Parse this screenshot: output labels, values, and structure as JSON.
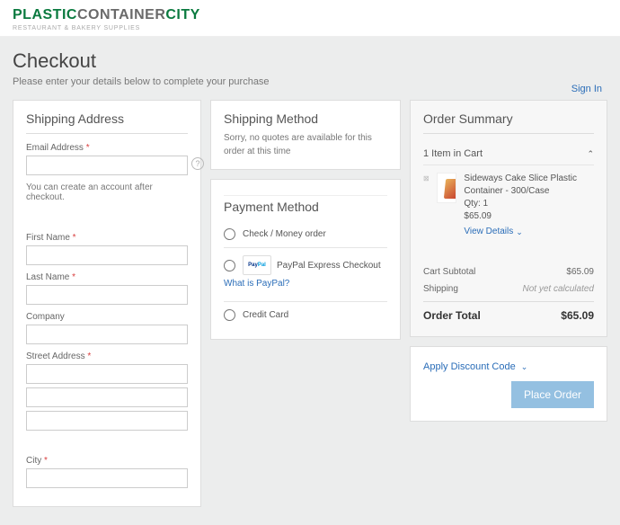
{
  "header": {
    "logo_p1": "PLASTIC",
    "logo_p2": "CONTAINER",
    "logo_p3": "CITY",
    "tagline": "RESTAURANT & BAKERY SUPPLIES"
  },
  "page": {
    "title": "Checkout",
    "lead": "Please enter your details below to complete your purchase",
    "signin": "Sign In"
  },
  "shipping_address": {
    "heading": "Shipping Address",
    "email_label": "Email Address",
    "email_value": "",
    "hint": "You can create an account after checkout.",
    "first_name_label": "First Name",
    "first_name_value": "",
    "last_name_label": "Last Name",
    "last_name_value": "",
    "company_label": "Company",
    "company_value": "",
    "street_label": "Street Address",
    "street1_value": "",
    "street2_value": "",
    "street3_value": "",
    "city_label": "City",
    "city_value": ""
  },
  "shipping_method": {
    "heading": "Shipping Method",
    "message": "Sorry, no quotes are available for this order at this time"
  },
  "payment": {
    "heading": "Payment Method",
    "options": [
      {
        "label": "Check / Money order"
      },
      {
        "label": "PayPal Express Checkout",
        "link": "What is PayPal?",
        "badge_p": "Pay",
        "badge_pal": "Pal"
      },
      {
        "label": "Credit Card"
      }
    ]
  },
  "summary": {
    "heading": "Order Summary",
    "cart_count_label": "1 Item in Cart",
    "item": {
      "name": "Sideways Cake Slice Plastic Container - 300/Case",
      "qty": "Qty: 1",
      "price": "$65.09",
      "view_details": "View Details"
    },
    "subtotal_label": "Cart Subtotal",
    "subtotal": "$65.09",
    "shipping_label": "Shipping",
    "shipping": "Not yet calculated",
    "total_label": "Order Total",
    "total": "$65.09",
    "discount_label": "Apply Discount Code",
    "place_order": "Place Order"
  }
}
